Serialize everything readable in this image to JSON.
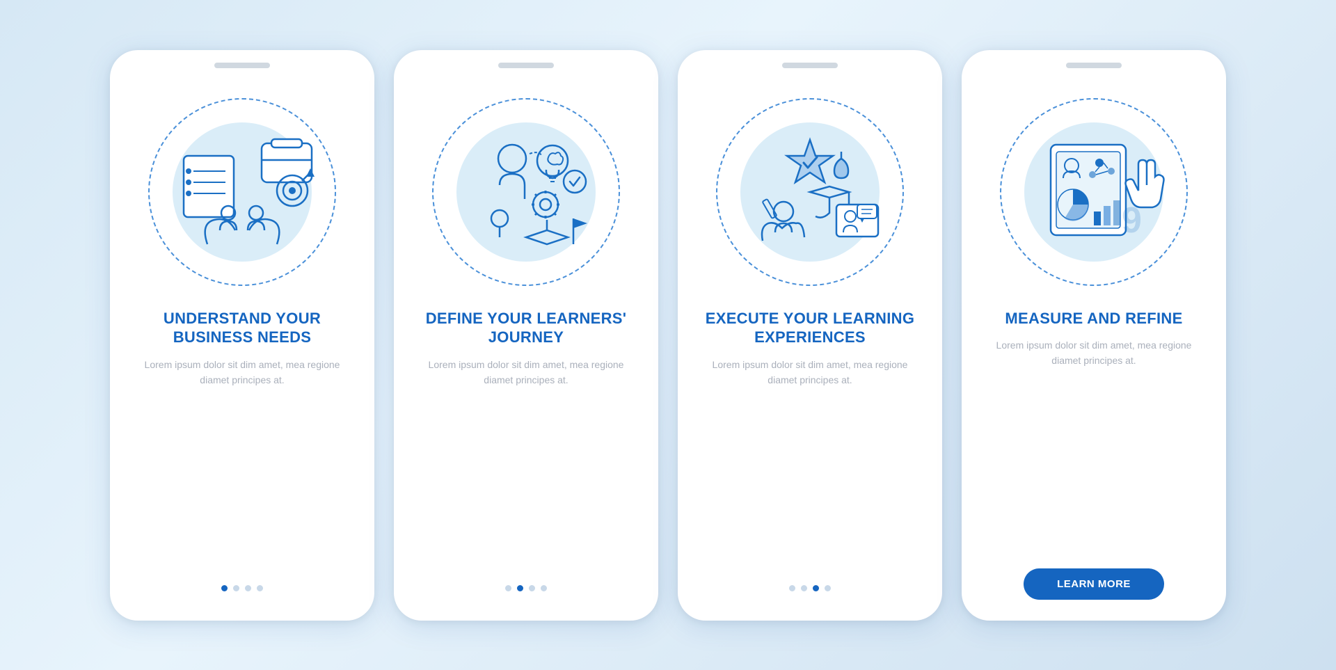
{
  "cards": [
    {
      "id": "card-1",
      "title": "UNDERSTAND YOUR BUSINESS NEEDS",
      "body": "Lorem ipsum dolor sit dim amet, mea regione diamet principes at.",
      "dots": [
        true,
        false,
        false,
        false
      ],
      "has_button": false,
      "icon": "business"
    },
    {
      "id": "card-2",
      "title": "DEFINE YOUR LEARNERS' JOURNEY",
      "body": "Lorem ipsum dolor sit dim amet, mea regione diamet principes at.",
      "dots": [
        false,
        true,
        false,
        false
      ],
      "has_button": false,
      "icon": "journey"
    },
    {
      "id": "card-3",
      "title": "EXECUTE YOUR LEARNING EXPERIENCES",
      "body": "Lorem ipsum dolor sit dim amet, mea regione diamet principes at.",
      "dots": [
        false,
        false,
        true,
        false
      ],
      "has_button": false,
      "icon": "learning"
    },
    {
      "id": "card-4",
      "title": "MEASURE AND REFINE",
      "body": "Lorem ipsum dolor sit dim amet, mea regione diamet principes at.",
      "dots": [
        false,
        false,
        false,
        true
      ],
      "has_button": true,
      "button_label": "LEARN MORE",
      "icon": "measure"
    }
  ]
}
